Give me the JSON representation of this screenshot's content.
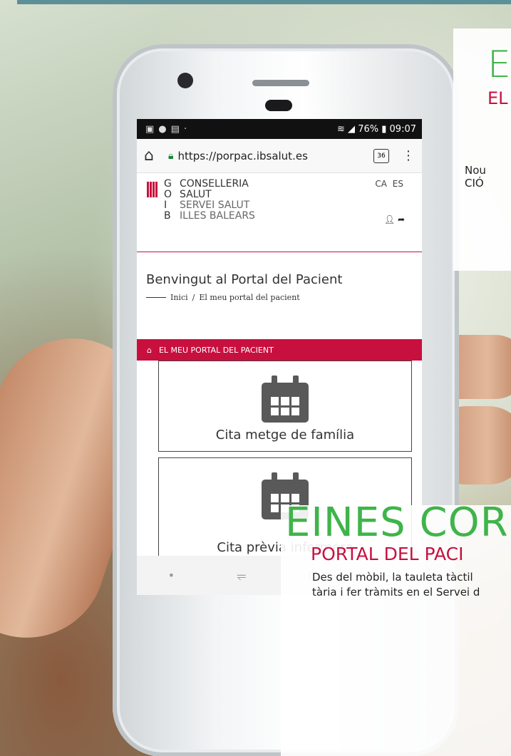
{
  "status_bar": {
    "battery": "76%",
    "time": "09:07"
  },
  "browser": {
    "url": "https://porpac.ibsalut.es",
    "tab_count": "36"
  },
  "site": {
    "logo_letters": [
      "G",
      "O",
      "I",
      "B"
    ],
    "org_lines": [
      "CONSELLERIA",
      "SALUT",
      "SERVEI SALUT",
      "ILLES BALEARS"
    ],
    "languages": "CA ES"
  },
  "page": {
    "title": "Benvingut al Portal del Pacient",
    "breadcrumb": [
      "Inici",
      "El meu portal del pacient"
    ],
    "section_bar": "EL MEU PORTAL DEL PACIENT",
    "cards": [
      {
        "label": "Cita metge de família"
      },
      {
        "label": "Cita prèvia infermera"
      }
    ]
  },
  "overlay_top": {
    "title": "E",
    "subtitle": "EL",
    "text_lines": [
      "Nou",
      "CIÓ"
    ]
  },
  "overlay_bottom": {
    "title": "EINES COR",
    "subtitle": "PORTAL DEL PACI",
    "text_lines": [
      "Des del mòbil, la tauleta tàctil",
      "tària i fer tràmits en el Servei d"
    ]
  },
  "colors": {
    "brand_red": "#c8103f",
    "accent_green": "#3fb44a",
    "top_bar": "#5d8f98"
  }
}
